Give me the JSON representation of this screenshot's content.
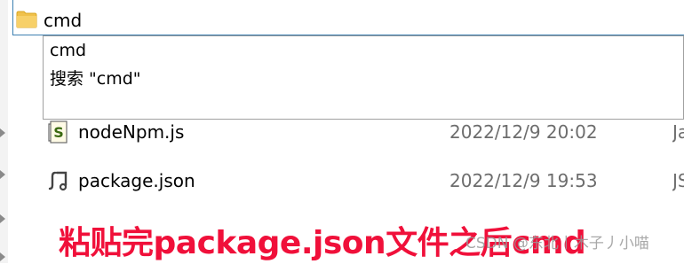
{
  "address_bar": {
    "value": "cmd",
    "icon": "folder-icon",
    "folder_color": "#f0c14b"
  },
  "autocomplete": {
    "options": [
      {
        "label": "cmd"
      },
      {
        "label": "搜索 \"cmd\""
      }
    ]
  },
  "files": [
    {
      "name": "nodeNpm.js",
      "modified": "2022/12/9 20:02",
      "type": "Ja",
      "icon": "js-file-icon"
    },
    {
      "name": "package.json",
      "modified": "2022/12/9 19:53",
      "type": "JS",
      "icon": "json-file-icon"
    }
  ],
  "caption": {
    "text": "粘贴完package.json文件之后cmd",
    "color": "#f0103a"
  },
  "watermark": {
    "text": "CSDN @东北丨木子丿小喵"
  }
}
